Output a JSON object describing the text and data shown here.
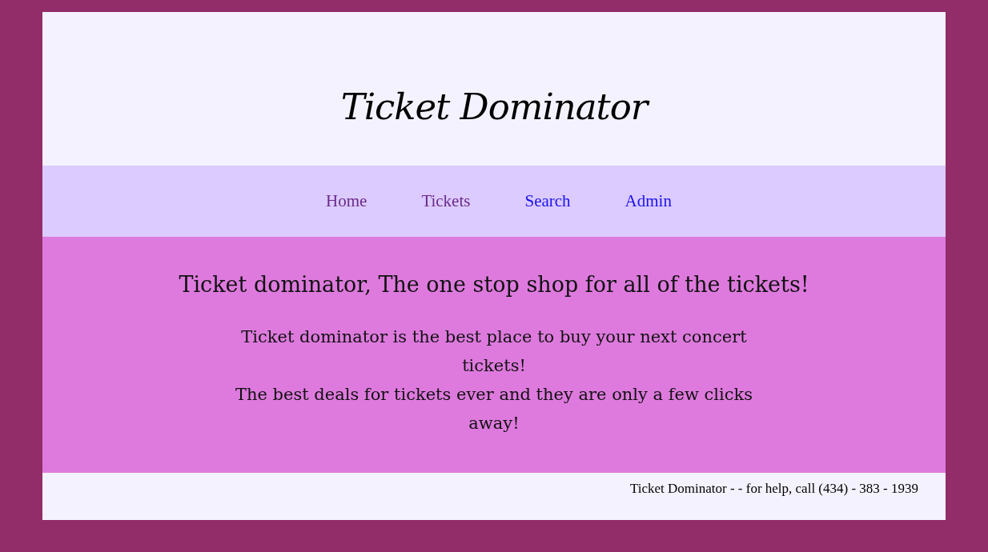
{
  "header": {
    "title": "Ticket Dominator"
  },
  "nav": {
    "links": [
      {
        "label": "Home",
        "visited": true
      },
      {
        "label": "Tickets",
        "visited": true
      },
      {
        "label": "Search",
        "visited": false
      },
      {
        "label": "Admin",
        "visited": false
      }
    ]
  },
  "main": {
    "heading": "Ticket dominator, The one stop shop for all of the tickets!",
    "paragraphs": [
      "Ticket dominator is the best place to buy your next concert tickets!",
      "The best deals for tickets ever and they are only a few clicks away!"
    ]
  },
  "footer": {
    "text": "Ticket Dominator - - for help, call (434) - 383 - 1939"
  }
}
